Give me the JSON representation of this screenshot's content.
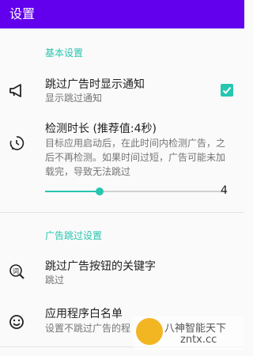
{
  "appbar": {
    "title": "设置"
  },
  "section_basic": {
    "title": "基本设置",
    "show_notice": {
      "title": "跳过广告时显示通知",
      "summary": "显示跳过通知",
      "checked": true,
      "icon": "megaphone-icon"
    },
    "detect_duration": {
      "title": "检测时长 (推荐值:4秒)",
      "summary": "目标应用启动后，在此时间内检测广告，之后不再检测。如果时间过短，广告可能未加载完，导致无法跳过",
      "value": "4",
      "level": 0.3,
      "icon": "timer-icon"
    }
  },
  "section_skip": {
    "title": "广告跳过设置",
    "keywords": {
      "title": "跳过广告按钮的关键字",
      "summary": "跳过",
      "icon": "keyword-icon"
    },
    "whitelist": {
      "title": "应用程序白名单",
      "summary": "设置不跳过广告的程",
      "icon": "smiley-icon"
    }
  },
  "watermark": {
    "line1": "八神智能天下",
    "line2": "zntx.cc"
  },
  "colors": {
    "appbar": "#6200ee",
    "accent": "#26c6b0"
  }
}
